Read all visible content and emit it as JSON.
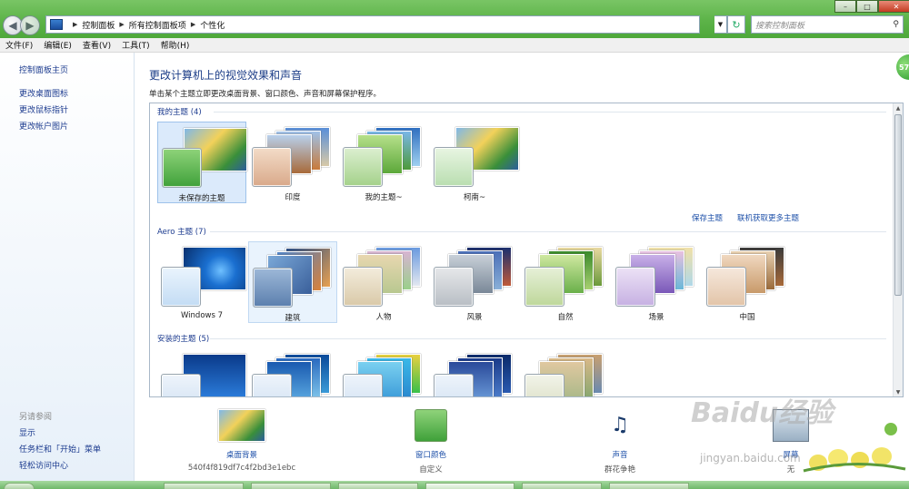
{
  "address": {
    "crumbs": [
      "控制面板",
      "所有控制面板项",
      "个性化"
    ],
    "search_placeholder": "搜索控制面板"
  },
  "menu": [
    "文件(F)",
    "编辑(E)",
    "查看(V)",
    "工具(T)",
    "帮助(H)"
  ],
  "sidebar": {
    "home": "控制面板主页",
    "links": [
      "更改桌面图标",
      "更改鼠标指针",
      "更改帐户图片"
    ],
    "see_also_heading": "另请参阅",
    "see_also": [
      "显示",
      "任务栏和「开始」菜单",
      "轻松访问中心"
    ]
  },
  "main": {
    "title": "更改计算机上的视觉效果和声音",
    "description": "单击某个主题立即更改桌面背景、窗口颜色、声音和屏幕保护程序。",
    "groups": {
      "my": {
        "heading": "我的主题 (4)",
        "themes": [
          "未保存的主题",
          "印度",
          "我的主题~",
          "柯南~"
        ]
      },
      "aero": {
        "heading": "Aero 主题 (7)",
        "themes": [
          "Windows 7",
          "建筑",
          "人物",
          "风景",
          "自然",
          "场景",
          "中国"
        ]
      },
      "installed": {
        "heading": "安装的主题 (5)"
      }
    },
    "save_theme": "保存主题",
    "get_more": "联机获取更多主题"
  },
  "quick_settings": [
    {
      "title": "桌面背景",
      "sub": "540f4f819df7c4f2bd3e1ebc"
    },
    {
      "title": "窗口颜色",
      "sub": "自定义"
    },
    {
      "title": "声音",
      "sub": "群花争艳"
    },
    {
      "title": "屏幕",
      "sub": "无"
    }
  ],
  "watermark": {
    "brand": "Baidu经验",
    "url": "jingyan.baidu.com"
  },
  "orb_text": "57",
  "colors": {
    "title_bar": "#5cb348",
    "link": "#1c4fa8",
    "heading": "#1b3c87",
    "selected": "#dbeafb"
  }
}
